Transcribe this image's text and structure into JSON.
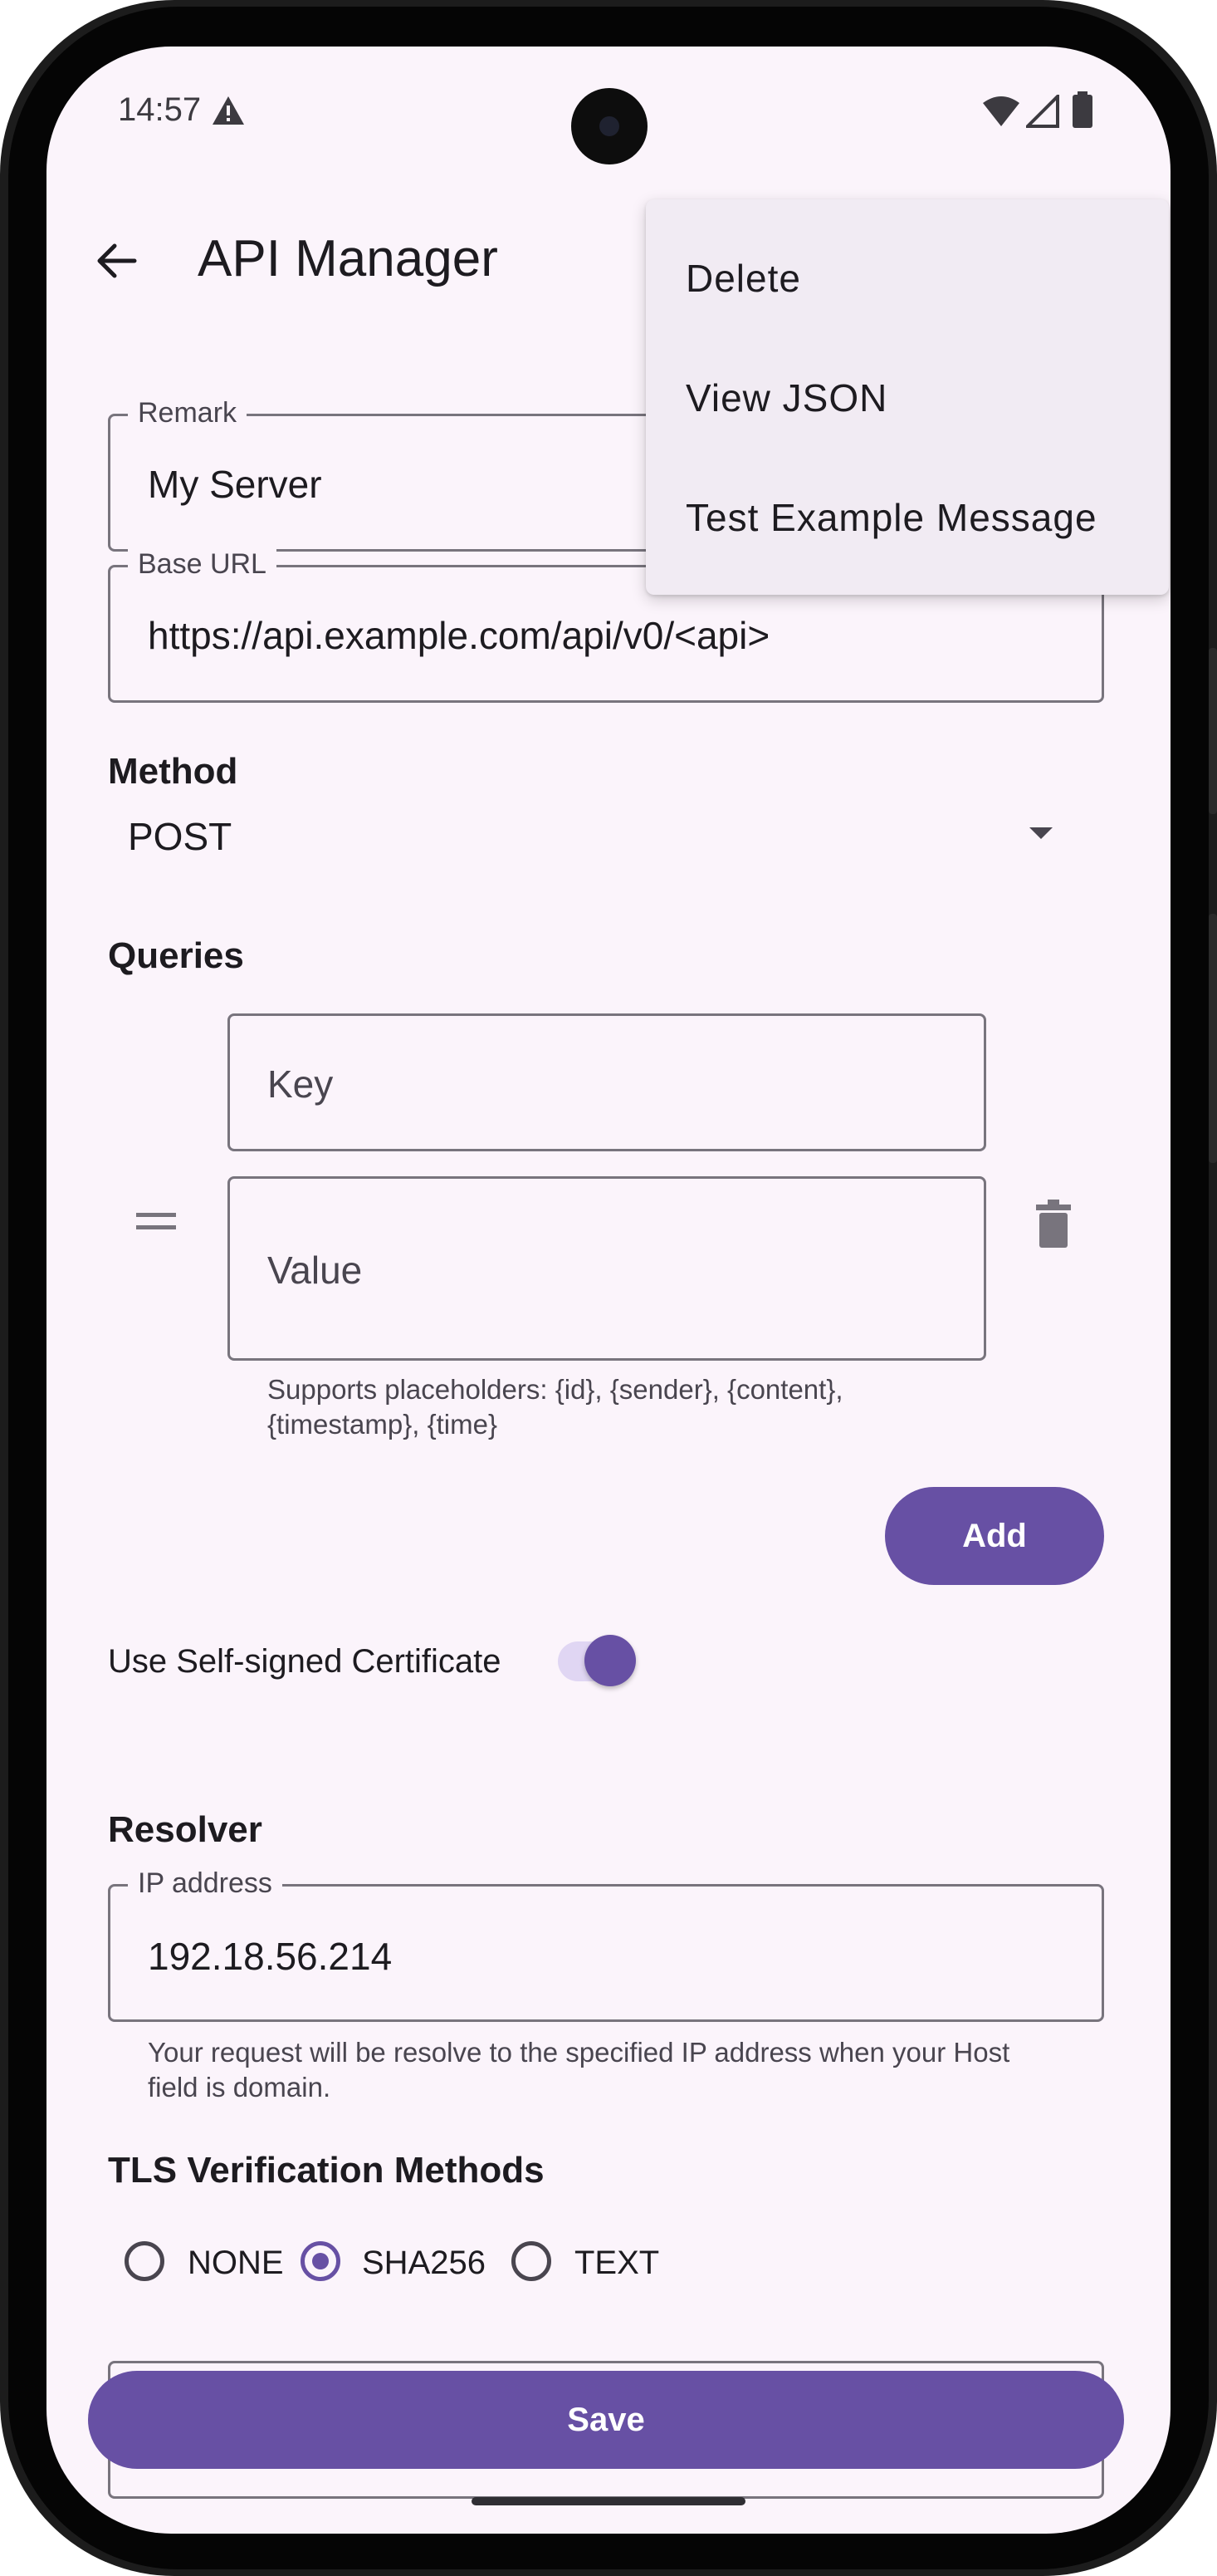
{
  "status": {
    "time": "14:57"
  },
  "app_bar": {
    "title": "API Manager"
  },
  "menu": {
    "items": [
      "Delete",
      "View JSON",
      "Test Example Message"
    ]
  },
  "remark": {
    "label": "Remark",
    "value": "My Server"
  },
  "base_url": {
    "label": "Base URL",
    "value": "https://api.example.com/api/v0/<api>"
  },
  "method": {
    "title": "Method",
    "value": "POST"
  },
  "queries": {
    "title": "Queries",
    "key_placeholder": "Key",
    "value_placeholder": "Value",
    "helper": "Supports placeholders: {id}, {sender}, {content}, {timestamp}, {time}",
    "add_label": "Add"
  },
  "self_signed": {
    "label": "Use Self-signed Certificate",
    "enabled": true
  },
  "resolver": {
    "title": "Resolver",
    "ip_label": "IP address",
    "ip_value": "192.18.56.214",
    "helper": "Your request will be resolve to the specified IP address when your Host field is domain."
  },
  "tls": {
    "title": "TLS Verification Methods",
    "options": [
      "NONE",
      "SHA256",
      "TEXT"
    ],
    "selected": "SHA256"
  },
  "save_label": "Save",
  "colors": {
    "primary": "#6750a4",
    "background": "#fbf4fb",
    "menu_bg": "#f1ebf3"
  },
  "icons": [
    "back-arrow-icon",
    "warning-icon",
    "wifi-icon",
    "signal-icon",
    "battery-icon",
    "drag-handle-icon",
    "delete-icon",
    "dropdown-arrow-icon"
  ]
}
